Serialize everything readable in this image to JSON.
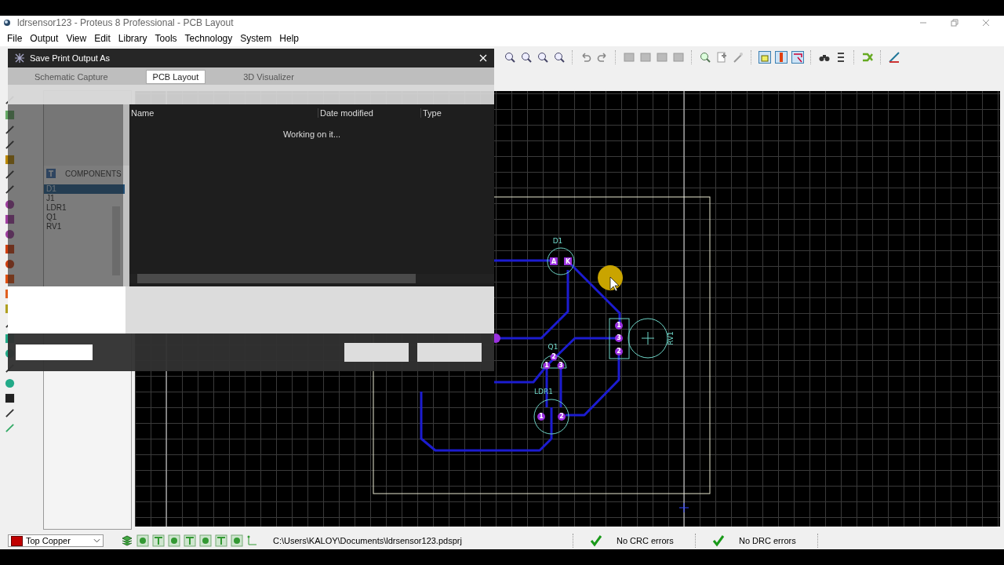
{
  "window": {
    "title": "ldrsensor123 - Proteus 8 Professional - PCB Layout"
  },
  "menu": [
    "File",
    "Output",
    "View",
    "Edit",
    "Library",
    "Tools",
    "Technology",
    "System",
    "Help"
  ],
  "tabs": [
    {
      "label": "Schematic Capture",
      "selected": false
    },
    {
      "label": "PCB Layout",
      "selected": true
    },
    {
      "label": "3D Visualizer",
      "selected": false
    }
  ],
  "toolbar": {
    "toggles": [
      {
        "selected": true
      },
      {
        "selected": true
      },
      {
        "selected": true
      }
    ]
  },
  "components_panel": {
    "title": "COMPONENTS",
    "items": [
      {
        "label": "D1",
        "selected": true
      },
      {
        "label": "J1",
        "selected": false
      },
      {
        "label": "LDR1",
        "selected": false
      },
      {
        "label": "Q1",
        "selected": false
      },
      {
        "label": "RV1",
        "selected": false
      }
    ]
  },
  "dialog": {
    "title": "Save Print Output As",
    "columns": [
      "Name",
      "Date modified",
      "Type"
    ],
    "status": "Working on it..."
  },
  "pcb": {
    "parts": [
      {
        "ref": "D1",
        "kind": "diode",
        "pads": [
          "A",
          "K"
        ]
      },
      {
        "ref": "Q1",
        "kind": "transistor",
        "pads": [
          "2",
          "1",
          "3"
        ]
      },
      {
        "ref": "LDR1",
        "kind": "ldr",
        "pads": [
          "1",
          "2"
        ]
      },
      {
        "ref": "RV1",
        "kind": "pot",
        "pads": [
          "1",
          "3",
          "2"
        ]
      }
    ]
  },
  "status_bar": {
    "layer": "Top Copper",
    "path": "C:\\Users\\KALOY\\Documents\\ldrsensor123.pdsprj",
    "checks": [
      "No CRC errors",
      "No DRC errors"
    ]
  }
}
